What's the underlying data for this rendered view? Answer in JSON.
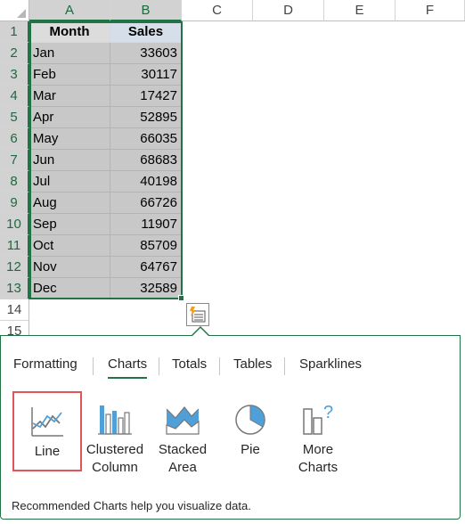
{
  "columns": [
    "A",
    "B",
    "C",
    "D",
    "E",
    "F"
  ],
  "rows": [
    "1",
    "2",
    "3",
    "4",
    "5",
    "6",
    "7",
    "8",
    "9",
    "10",
    "11",
    "12",
    "13",
    "14",
    "15"
  ],
  "table": {
    "headers": [
      "Month",
      "Sales"
    ],
    "data": [
      [
        "Jan",
        "33603"
      ],
      [
        "Feb",
        "30117"
      ],
      [
        "Mar",
        "17427"
      ],
      [
        "Apr",
        "52895"
      ],
      [
        "May",
        "66035"
      ],
      [
        "Jun",
        "68683"
      ],
      [
        "Jul",
        "40198"
      ],
      [
        "Aug",
        "66726"
      ],
      [
        "Sep",
        "11907"
      ],
      [
        "Oct",
        "85709"
      ],
      [
        "Nov",
        "64767"
      ],
      [
        "Dec",
        "32589"
      ]
    ]
  },
  "quick_analysis": {
    "tabs": [
      "Formatting",
      "Charts",
      "Totals",
      "Tables",
      "Sparklines"
    ],
    "active_tab": "Charts",
    "options": [
      {
        "label": "Line",
        "icon": "line-chart-icon"
      },
      {
        "label": "Clustered\nColumn",
        "icon": "clustered-column-icon"
      },
      {
        "label": "Stacked\nArea",
        "icon": "stacked-area-icon"
      },
      {
        "label": "Pie",
        "icon": "pie-chart-icon"
      },
      {
        "label": "More\nCharts",
        "icon": "more-charts-icon"
      }
    ],
    "selected_option": "Line",
    "footer": "Recommended Charts help you visualize data."
  },
  "colors": {
    "accent_green": "#217346",
    "selection_red": "#e0555a",
    "icon_blue": "#4f9fd8"
  }
}
